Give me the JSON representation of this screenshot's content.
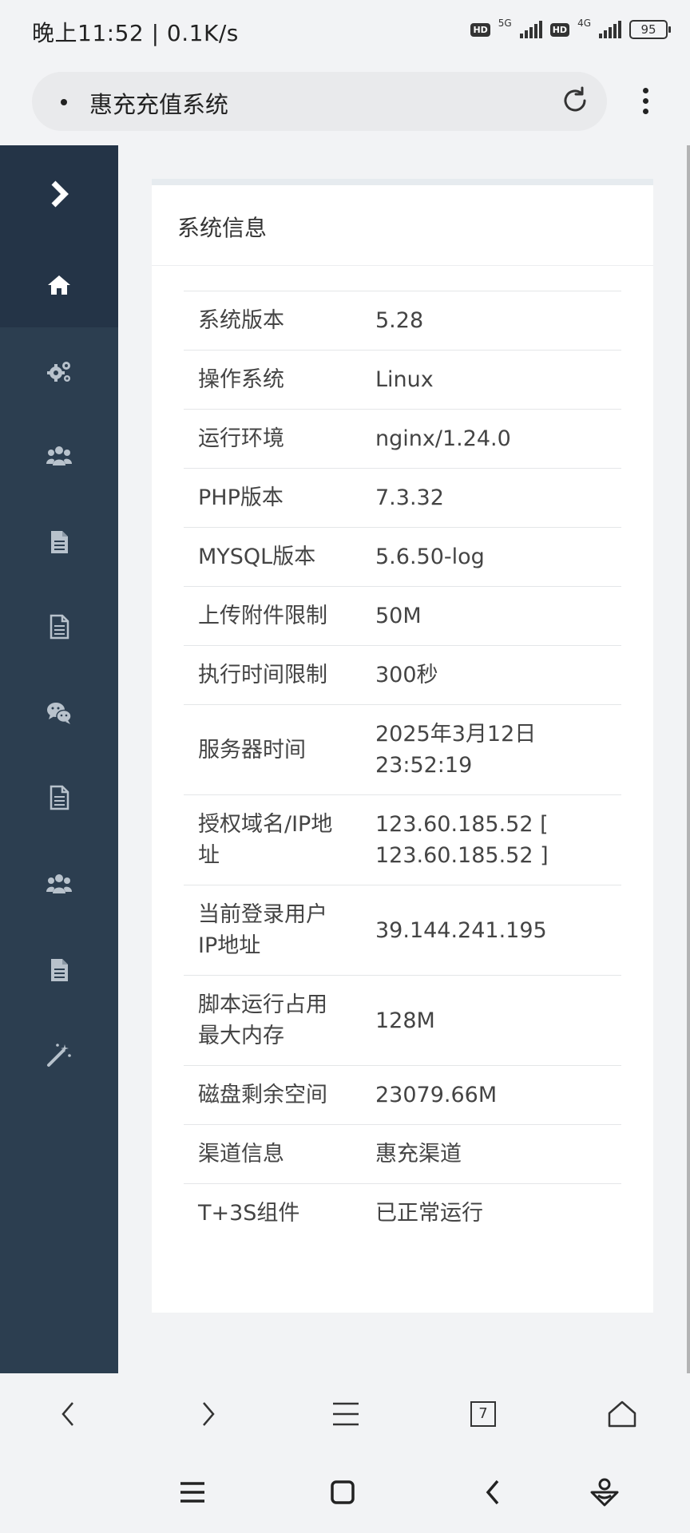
{
  "status_bar": {
    "time": "晚上11:52 | 0.1K/s",
    "sim1_badge": "HD",
    "sim1_network": "5G",
    "sim2_badge": "HD",
    "sim2_network": "4G",
    "battery": "95"
  },
  "browser": {
    "page_title": "惠充充值系统",
    "tab_count": "7"
  },
  "sidebar": {
    "items": [
      {
        "icon": "home-icon",
        "active": true
      },
      {
        "icon": "gears-icon"
      },
      {
        "icon": "users-icon"
      },
      {
        "icon": "document-icon"
      },
      {
        "icon": "document-outline-icon"
      },
      {
        "icon": "wechat-icon"
      },
      {
        "icon": "document-outline-icon"
      },
      {
        "icon": "users-icon"
      },
      {
        "icon": "document-icon"
      },
      {
        "icon": "magic-wand-icon"
      }
    ]
  },
  "panel": {
    "title": "系统信息",
    "rows": [
      {
        "label": "系统版本",
        "value": "5.28"
      },
      {
        "label": "操作系统",
        "value": "Linux"
      },
      {
        "label": "运行环境",
        "value": "nginx/1.24.0"
      },
      {
        "label": "PHP版本",
        "value": "7.3.32"
      },
      {
        "label": "MYSQL版本",
        "value": "5.6.50-log"
      },
      {
        "label": "上传附件限制",
        "value": "50M"
      },
      {
        "label": "执行时间限制",
        "value": "300秒"
      },
      {
        "label": "服务器时间",
        "value": "2025年3月12日 23:52:19"
      },
      {
        "label": "授权域名/IP地址",
        "value": "123.60.185.52 [ 123.60.185.52 ]"
      },
      {
        "label": "当前登录用户IP地址",
        "value": "39.144.241.195"
      },
      {
        "label": "脚本运行占用最大内存",
        "value": "128M"
      },
      {
        "label": "磁盘剩余空间",
        "value": "23079.66M"
      },
      {
        "label": "渠道信息",
        "value": "惠充渠道"
      },
      {
        "label": "T+3S组件",
        "value": "已正常运行"
      }
    ]
  }
}
